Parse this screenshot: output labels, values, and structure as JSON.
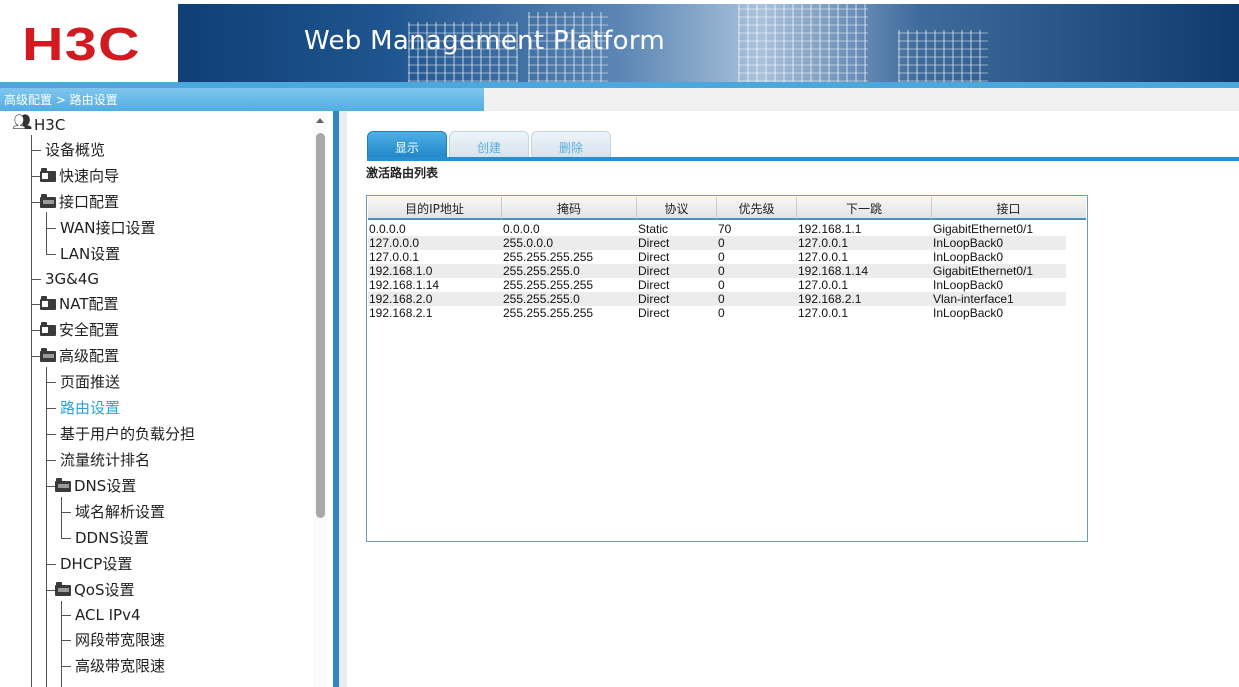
{
  "header": {
    "logo_text": "H3C",
    "platform_title": "Web Management Platform",
    "brand_color": "#d31a20"
  },
  "breadcrumb": "高级配置 > 路由设置",
  "sidebar": {
    "root": "H3C",
    "items": [
      {
        "label": "设备概览"
      },
      {
        "label": "快速向导"
      },
      {
        "label": "接口配置"
      },
      {
        "label": "WAN接口设置"
      },
      {
        "label": "LAN设置"
      },
      {
        "label": "3G&4G"
      },
      {
        "label": "NAT配置"
      },
      {
        "label": "安全配置"
      },
      {
        "label": "高级配置"
      },
      {
        "label": "页面推送"
      },
      {
        "label": "路由设置"
      },
      {
        "label": "基于用户的负载分担"
      },
      {
        "label": "流量统计排名"
      },
      {
        "label": "DNS设置"
      },
      {
        "label": "域名解析设置"
      },
      {
        "label": "DDNS设置"
      },
      {
        "label": "DHCP设置"
      },
      {
        "label": "QoS设置"
      },
      {
        "label": "ACL IPv4"
      },
      {
        "label": "网段带宽限速"
      },
      {
        "label": "高级带宽限速"
      }
    ],
    "active_item": "路由设置"
  },
  "tabs": [
    {
      "label": "显示",
      "active": true
    },
    {
      "label": "创建",
      "active": false
    },
    {
      "label": "删除",
      "active": false
    }
  ],
  "section_title": "激活路由列表",
  "route_table": {
    "columns": [
      "目的IP地址",
      "掩码",
      "协议",
      "优先级",
      "下一跳",
      "接口"
    ],
    "rows": [
      [
        "0.0.0.0",
        "0.0.0.0",
        "Static",
        "70",
        "192.168.1.1",
        "GigabitEthernet0/1"
      ],
      [
        "127.0.0.0",
        "255.0.0.0",
        "Direct",
        "0",
        "127.0.0.1",
        "InLoopBack0"
      ],
      [
        "127.0.0.1",
        "255.255.255.255",
        "Direct",
        "0",
        "127.0.0.1",
        "InLoopBack0"
      ],
      [
        "192.168.1.0",
        "255.255.255.0",
        "Direct",
        "0",
        "192.168.1.14",
        "GigabitEthernet0/1"
      ],
      [
        "192.168.1.14",
        "255.255.255.255",
        "Direct",
        "0",
        "127.0.0.1",
        "InLoopBack0"
      ],
      [
        "192.168.2.0",
        "255.255.255.0",
        "Direct",
        "0",
        "192.168.2.1",
        "Vlan-interface1"
      ],
      [
        "192.168.2.1",
        "255.255.255.255",
        "Direct",
        "0",
        "127.0.0.1",
        "InLoopBack0"
      ]
    ]
  }
}
